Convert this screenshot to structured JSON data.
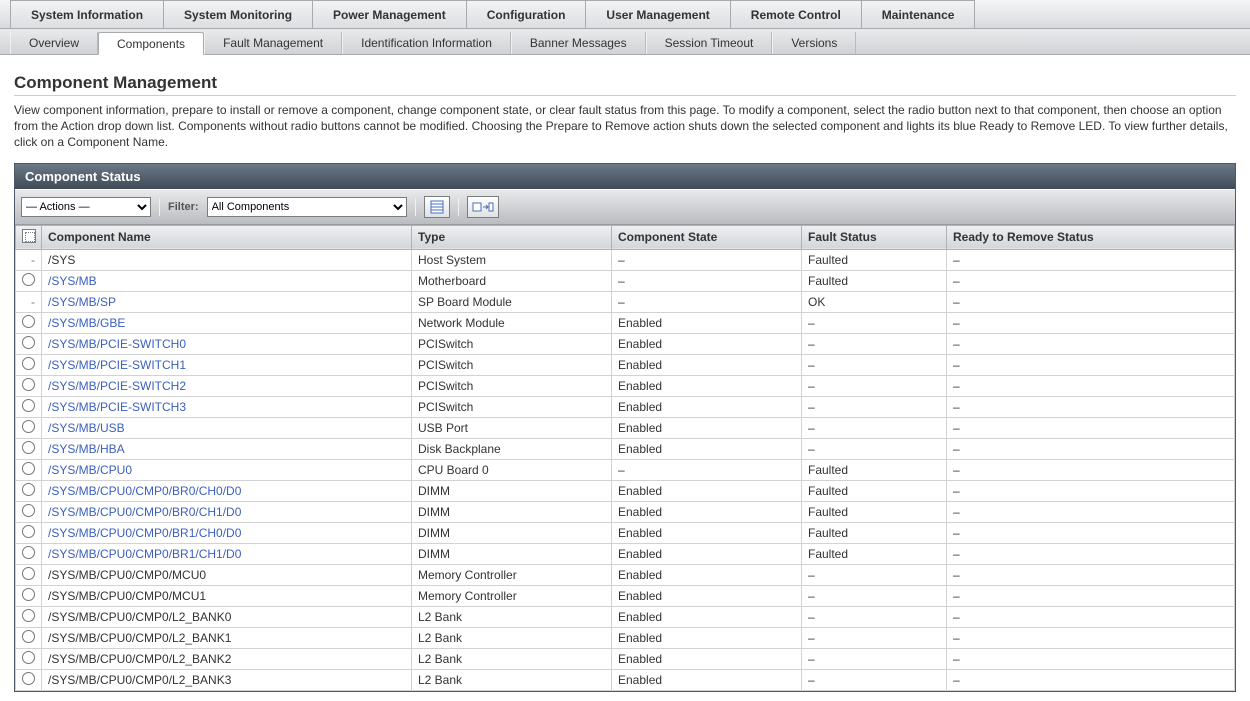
{
  "topTabs": [
    "System Information",
    "System Monitoring",
    "Power Management",
    "Configuration",
    "User Management",
    "Remote Control",
    "Maintenance"
  ],
  "activeTopTab": 0,
  "subTabs": [
    "Overview",
    "Components",
    "Fault Management",
    "Identification Information",
    "Banner Messages",
    "Session Timeout",
    "Versions"
  ],
  "activeSubTab": 1,
  "page": {
    "title": "Component Management",
    "description": "View component information, prepare to install or remove a component, change component state, or clear fault status from this page. To modify a component, select the radio button next to that component, then choose an option from the Action drop down list. Components without radio buttons cannot be modified. Choosing the Prepare to Remove action shuts down the selected component and lights its blue Ready to Remove LED. To view further details, click on a Component Name."
  },
  "panel": {
    "title": "Component Status",
    "actionsLabel": "— Actions —",
    "filterLabel": "Filter:",
    "filterValue": "All Components"
  },
  "columns": [
    "Component Name",
    "Type",
    "Component State",
    "Fault Status",
    "Ready to Remove Status"
  ],
  "rows": [
    {
      "sel": "dash",
      "link": false,
      "name": "/SYS",
      "type": "Host System",
      "state": "–",
      "fault": "Faulted",
      "rtr": "–"
    },
    {
      "sel": "radio",
      "link": true,
      "name": "/SYS/MB",
      "type": "Motherboard",
      "state": "–",
      "fault": "Faulted",
      "rtr": "–"
    },
    {
      "sel": "dash",
      "link": true,
      "name": "/SYS/MB/SP",
      "type": "SP Board Module",
      "state": "–",
      "fault": "OK",
      "rtr": "–"
    },
    {
      "sel": "radio",
      "link": true,
      "name": "/SYS/MB/GBE",
      "type": "Network Module",
      "state": "Enabled",
      "fault": "–",
      "rtr": "–"
    },
    {
      "sel": "radio",
      "link": true,
      "name": "/SYS/MB/PCIE-SWITCH0",
      "type": "PCISwitch",
      "state": "Enabled",
      "fault": "–",
      "rtr": "–"
    },
    {
      "sel": "radio",
      "link": true,
      "name": "/SYS/MB/PCIE-SWITCH1",
      "type": "PCISwitch",
      "state": "Enabled",
      "fault": "–",
      "rtr": "–"
    },
    {
      "sel": "radio",
      "link": true,
      "name": "/SYS/MB/PCIE-SWITCH2",
      "type": "PCISwitch",
      "state": "Enabled",
      "fault": "–",
      "rtr": "–"
    },
    {
      "sel": "radio",
      "link": true,
      "name": "/SYS/MB/PCIE-SWITCH3",
      "type": "PCISwitch",
      "state": "Enabled",
      "fault": "–",
      "rtr": "–"
    },
    {
      "sel": "radio",
      "link": true,
      "name": "/SYS/MB/USB",
      "type": "USB Port",
      "state": "Enabled",
      "fault": "–",
      "rtr": "–"
    },
    {
      "sel": "radio",
      "link": true,
      "name": "/SYS/MB/HBA",
      "type": "Disk Backplane",
      "state": "Enabled",
      "fault": "–",
      "rtr": "–"
    },
    {
      "sel": "radio",
      "link": true,
      "name": "/SYS/MB/CPU0",
      "type": "CPU Board 0",
      "state": "–",
      "fault": "Faulted",
      "rtr": "–"
    },
    {
      "sel": "radio",
      "link": true,
      "name": "/SYS/MB/CPU0/CMP0/BR0/CH0/D0",
      "type": "DIMM",
      "state": "Enabled",
      "fault": "Faulted",
      "rtr": "–"
    },
    {
      "sel": "radio",
      "link": true,
      "name": "/SYS/MB/CPU0/CMP0/BR0/CH1/D0",
      "type": "DIMM",
      "state": "Enabled",
      "fault": "Faulted",
      "rtr": "–"
    },
    {
      "sel": "radio",
      "link": true,
      "name": "/SYS/MB/CPU0/CMP0/BR1/CH0/D0",
      "type": "DIMM",
      "state": "Enabled",
      "fault": "Faulted",
      "rtr": "–"
    },
    {
      "sel": "radio",
      "link": true,
      "name": "/SYS/MB/CPU0/CMP0/BR1/CH1/D0",
      "type": "DIMM",
      "state": "Enabled",
      "fault": "Faulted",
      "rtr": "–"
    },
    {
      "sel": "radio",
      "link": false,
      "name": "/SYS/MB/CPU0/CMP0/MCU0",
      "type": "Memory Controller",
      "state": "Enabled",
      "fault": "–",
      "rtr": "–"
    },
    {
      "sel": "radio",
      "link": false,
      "name": "/SYS/MB/CPU0/CMP0/MCU1",
      "type": "Memory Controller",
      "state": "Enabled",
      "fault": "–",
      "rtr": "–"
    },
    {
      "sel": "radio",
      "link": false,
      "name": "/SYS/MB/CPU0/CMP0/L2_BANK0",
      "type": "L2 Bank",
      "state": "Enabled",
      "fault": "–",
      "rtr": "–"
    },
    {
      "sel": "radio",
      "link": false,
      "name": "/SYS/MB/CPU0/CMP0/L2_BANK1",
      "type": "L2 Bank",
      "state": "Enabled",
      "fault": "–",
      "rtr": "–"
    },
    {
      "sel": "radio",
      "link": false,
      "name": "/SYS/MB/CPU0/CMP0/L2_BANK2",
      "type": "L2 Bank",
      "state": "Enabled",
      "fault": "–",
      "rtr": "–"
    },
    {
      "sel": "radio",
      "link": false,
      "name": "/SYS/MB/CPU0/CMP0/L2_BANK3",
      "type": "L2 Bank",
      "state": "Enabled",
      "fault": "–",
      "rtr": "–"
    }
  ]
}
